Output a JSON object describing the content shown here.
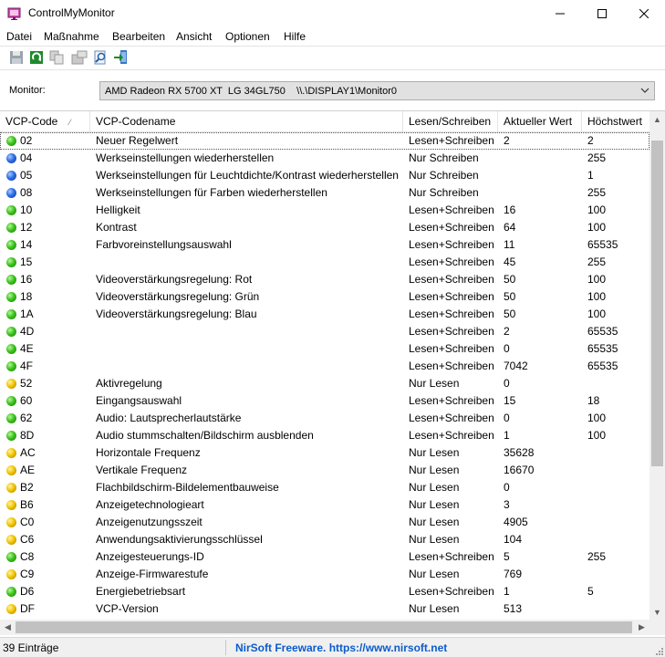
{
  "window": {
    "title": "ControlMyMonitor"
  },
  "menu": [
    "Datei",
    "Maßnahme",
    "Bearbeiten",
    "Ansicht",
    "Optionen",
    "Hilfe"
  ],
  "toolbar": [
    "save-icon",
    "refresh-icon",
    "copy-icon",
    "properties-icon",
    "find-icon",
    "exit-icon"
  ],
  "monitor": {
    "label": "Monitor:",
    "value": "AMD Radeon RX 5700 XT  LG 34GL750    \\\\.\\DISPLAY1\\Monitor0"
  },
  "table": {
    "columns": [
      "VCP-Code",
      "VCP-Codename",
      "Lesen/Schreiben",
      "Aktueller Wert",
      "Höchstwert"
    ],
    "rows": [
      {
        "status": "green",
        "code": "02",
        "name": "Neuer Regelwert",
        "rw": "Lesen+Schreiben",
        "current": "2",
        "max": "2"
      },
      {
        "status": "blue",
        "code": "04",
        "name": "Werkseinstellungen wiederherstellen",
        "rw": "Nur Schreiben",
        "current": "",
        "max": "255"
      },
      {
        "status": "blue",
        "code": "05",
        "name": "Werkseinstellungen für Leuchtdichte/Kontrast wiederherstellen",
        "rw": "Nur Schreiben",
        "current": "",
        "max": "1"
      },
      {
        "status": "blue",
        "code": "08",
        "name": "Werkseinstellungen für Farben wiederherstellen",
        "rw": "Nur Schreiben",
        "current": "",
        "max": "255"
      },
      {
        "status": "green",
        "code": "10",
        "name": "Helligkeit",
        "rw": "Lesen+Schreiben",
        "current": "16",
        "max": "100"
      },
      {
        "status": "green",
        "code": "12",
        "name": "Kontrast",
        "rw": "Lesen+Schreiben",
        "current": "64",
        "max": "100"
      },
      {
        "status": "green",
        "code": "14",
        "name": "Farbvoreinstellungsauswahl",
        "rw": "Lesen+Schreiben",
        "current": "11",
        "max": "65535"
      },
      {
        "status": "green",
        "code": "15",
        "name": "",
        "rw": "Lesen+Schreiben",
        "current": "45",
        "max": "255"
      },
      {
        "status": "green",
        "code": "16",
        "name": "Videoverstärkungsregelung: Rot",
        "rw": "Lesen+Schreiben",
        "current": "50",
        "max": "100"
      },
      {
        "status": "green",
        "code": "18",
        "name": "Videoverstärkungsregelung: Grün",
        "rw": "Lesen+Schreiben",
        "current": "50",
        "max": "100"
      },
      {
        "status": "green",
        "code": "1A",
        "name": "Videoverstärkungsregelung: Blau",
        "rw": "Lesen+Schreiben",
        "current": "50",
        "max": "100"
      },
      {
        "status": "green",
        "code": "4D",
        "name": "",
        "rw": "Lesen+Schreiben",
        "current": "2",
        "max": "65535"
      },
      {
        "status": "green",
        "code": "4E",
        "name": "",
        "rw": "Lesen+Schreiben",
        "current": "0",
        "max": "65535"
      },
      {
        "status": "green",
        "code": "4F",
        "name": "",
        "rw": "Lesen+Schreiben",
        "current": "7042",
        "max": "65535"
      },
      {
        "status": "yellow",
        "code": "52",
        "name": "Aktivregelung",
        "rw": "Nur Lesen",
        "current": "0",
        "max": ""
      },
      {
        "status": "green",
        "code": "60",
        "name": "Eingangsauswahl",
        "rw": "Lesen+Schreiben",
        "current": "15",
        "max": "18"
      },
      {
        "status": "green",
        "code": "62",
        "name": "Audio: Lautsprecherlautstärke",
        "rw": "Lesen+Schreiben",
        "current": "0",
        "max": "100"
      },
      {
        "status": "green",
        "code": "8D",
        "name": "Audio stummschalten/Bildschirm ausblenden",
        "rw": "Lesen+Schreiben",
        "current": "1",
        "max": "100"
      },
      {
        "status": "yellow",
        "code": "AC",
        "name": "Horizontale Frequenz",
        "rw": "Nur Lesen",
        "current": "35628",
        "max": ""
      },
      {
        "status": "yellow",
        "code": "AE",
        "name": "Vertikale Frequenz",
        "rw": "Nur Lesen",
        "current": "16670",
        "max": ""
      },
      {
        "status": "yellow",
        "code": "B2",
        "name": "Flachbildschirm-Bildelementbauweise",
        "rw": "Nur Lesen",
        "current": "0",
        "max": ""
      },
      {
        "status": "yellow",
        "code": "B6",
        "name": "Anzeigetechnologieart",
        "rw": "Nur Lesen",
        "current": "3",
        "max": ""
      },
      {
        "status": "yellow",
        "code": "C0",
        "name": "Anzeigenutzungsszeit",
        "rw": "Nur Lesen",
        "current": "4905",
        "max": ""
      },
      {
        "status": "yellow",
        "code": "C6",
        "name": "Anwendungsaktivierungsschlüssel",
        "rw": "Nur Lesen",
        "current": "104",
        "max": ""
      },
      {
        "status": "green",
        "code": "C8",
        "name": "Anzeigesteuerungs-ID",
        "rw": "Lesen+Schreiben",
        "current": "5",
        "max": "255"
      },
      {
        "status": "yellow",
        "code": "C9",
        "name": "Anzeige-Firmwarestufe",
        "rw": "Nur Lesen",
        "current": "769",
        "max": ""
      },
      {
        "status": "green",
        "code": "D6",
        "name": "Energiebetriebsart",
        "rw": "Lesen+Schreiben",
        "current": "1",
        "max": "5"
      },
      {
        "status": "yellow",
        "code": "DF",
        "name": "VCP-Version",
        "rw": "Nur Lesen",
        "current": "513",
        "max": ""
      }
    ]
  },
  "status": {
    "count": "39 Einträge",
    "link": "NirSoft Freeware. https://www.nirsoft.net"
  }
}
